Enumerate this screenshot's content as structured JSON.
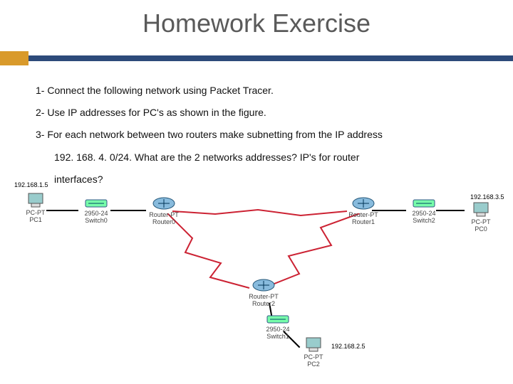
{
  "title": "Homework Exercise",
  "instructions": {
    "l1": "1- Connect the following network using Packet Tracer.",
    "l2": "2- Use IP addresses for PC's as shown in the figure.",
    "l3": "3- For each network between two routers make subnetting from the IP address",
    "l4": "192. 168. 4. 0/24. What are the 2 networks addresses? IP's for router",
    "l5": "interfaces?"
  },
  "nodes": {
    "pc1": {
      "label_top": "PC-PT",
      "label_bot": "PC1"
    },
    "sw0": {
      "label_top": "2950-24",
      "label_bot": "Switch0"
    },
    "r0": {
      "label_top": "Router-PT",
      "label_bot": "Router0"
    },
    "r1": {
      "label_top": "Router-PT",
      "label_bot": "Router1"
    },
    "sw2": {
      "label_top": "2950-24",
      "label_bot": "Switch2"
    },
    "pc0": {
      "label_top": "PC-PT",
      "label_bot": "PC0"
    },
    "r2": {
      "label_top": "Router-PT",
      "label_bot": "Router2"
    },
    "sw1": {
      "label_top": "2950-24",
      "label_bot": "Switch1"
    },
    "pc2": {
      "label_top": "PC-PT",
      "label_bot": "PC2"
    }
  },
  "ips": {
    "pc1": "192.168.1.5",
    "pc0": "192.168.3.5",
    "pc2": "192.168.2.5"
  }
}
